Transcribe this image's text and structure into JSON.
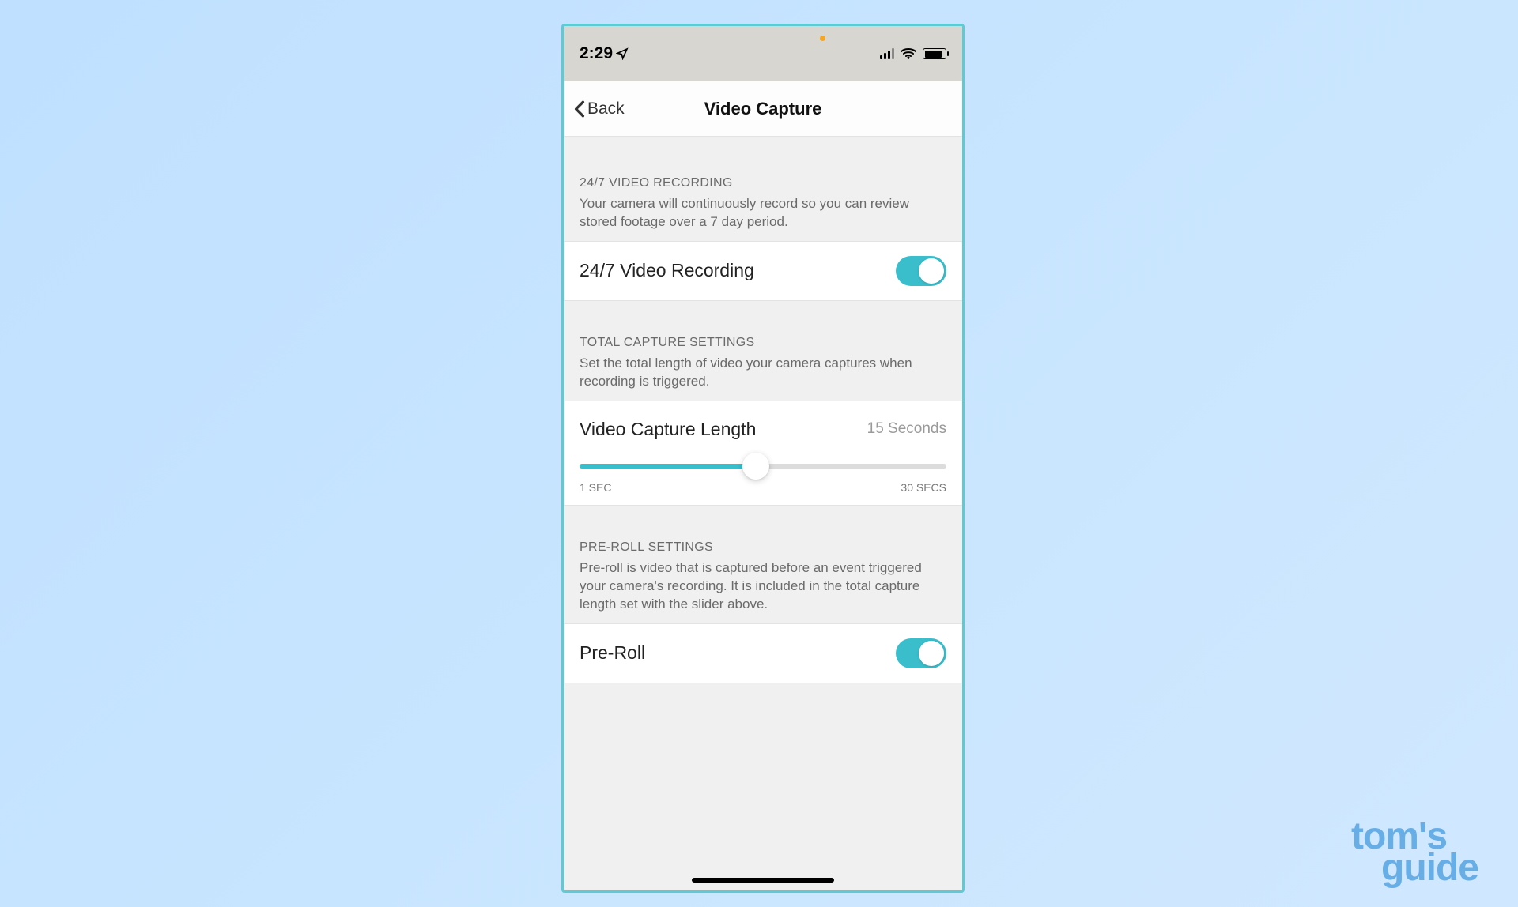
{
  "statusBar": {
    "time": "2:29"
  },
  "nav": {
    "back": "Back",
    "title": "Video Capture"
  },
  "section247": {
    "title": "24/7 VIDEO RECORDING",
    "desc": "Your camera will continuously record so you can review stored footage over a 7 day period.",
    "rowLabel": "24/7 Video Recording",
    "toggleOn": true
  },
  "sectionCapture": {
    "title": "TOTAL CAPTURE SETTINGS",
    "desc": "Set the total length of video your camera captures when recording is triggered.",
    "rowLabel": "Video Capture Length",
    "rowValue": "15 Seconds",
    "sliderMinLabel": "1 SEC",
    "sliderMaxLabel": "30 SECS",
    "sliderMin": 1,
    "sliderMax": 30,
    "sliderValue": 15
  },
  "sectionPreroll": {
    "title": "PRE-ROLL SETTINGS",
    "desc": "Pre-roll is video that is captured before an event triggered your camera's recording. It is included in the total capture length set with the slider above.",
    "rowLabel": "Pre-Roll",
    "toggleOn": true
  },
  "watermark": {
    "line1": "tom's",
    "line2": "guide"
  }
}
